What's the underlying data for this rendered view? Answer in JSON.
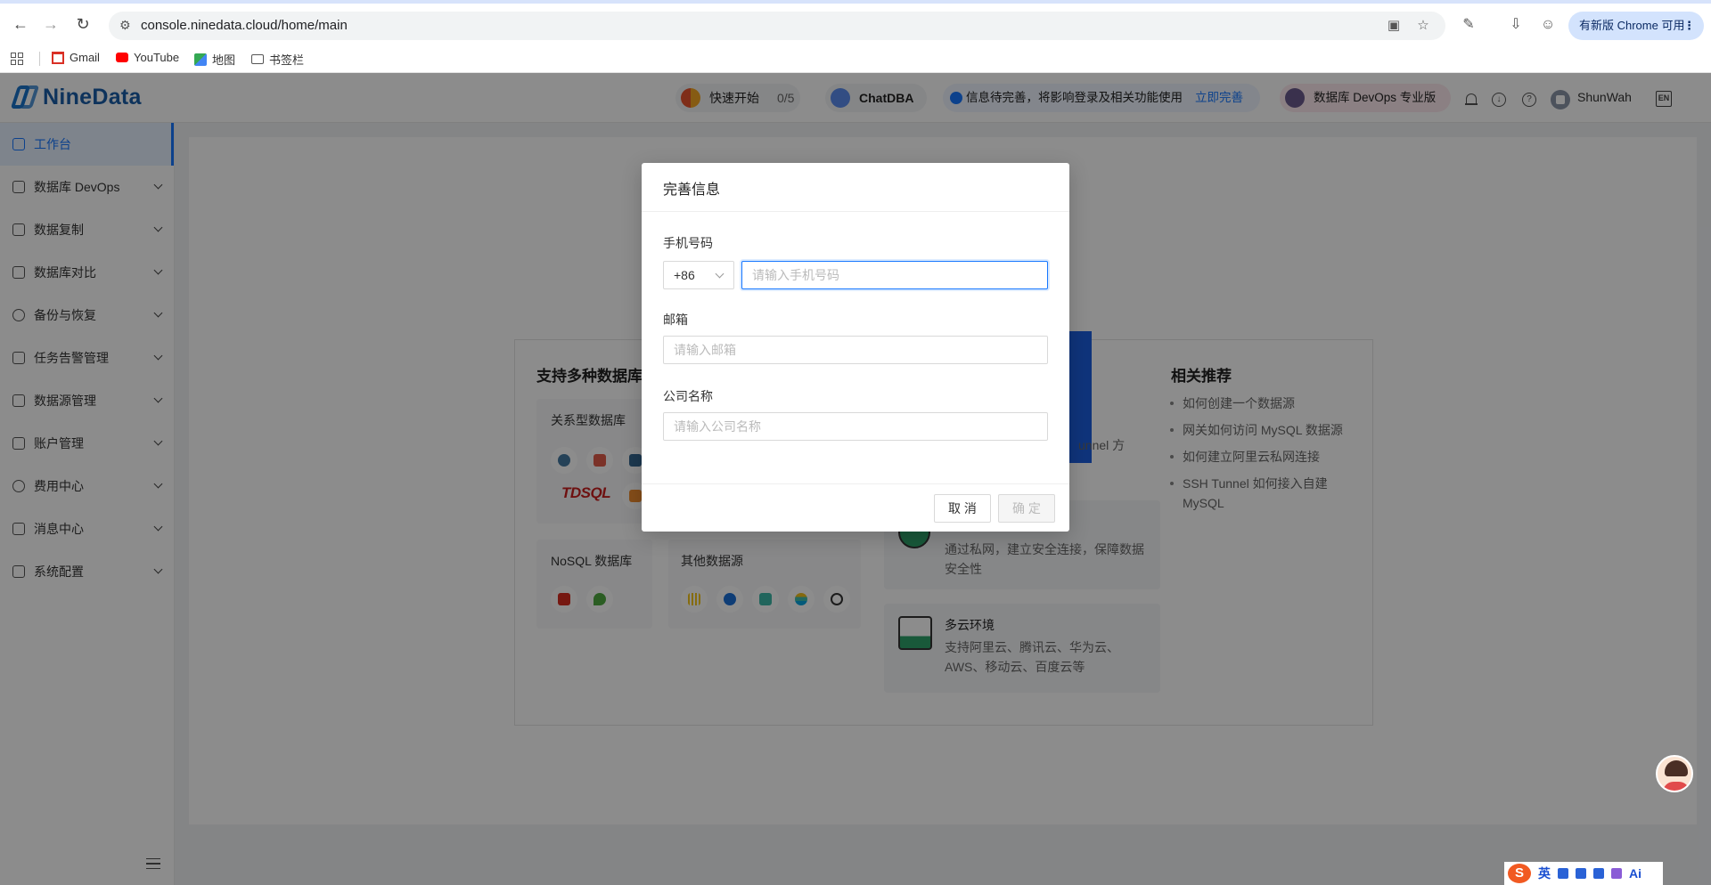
{
  "browser": {
    "url": "console.ninedata.cloud/home/main",
    "update_label": "有新版 Chrome 可用",
    "bookmarks": [
      {
        "label": "Gmail"
      },
      {
        "label": "YouTube"
      },
      {
        "label": "地图"
      },
      {
        "label": "书签栏"
      }
    ]
  },
  "header": {
    "brand": "NineData",
    "quick_start_label": "快速开始",
    "quick_start_progress": "0/5",
    "chatdba_label": "ChatDBA",
    "notice_text": "信息待完善，将影响登录及相关功能使用",
    "notice_link": "立即完善",
    "edition_label": "数据库 DevOps 专业版",
    "username": "ShunWah"
  },
  "sidebar": {
    "items": [
      {
        "label": "工作台"
      },
      {
        "label": "数据库 DevOps"
      },
      {
        "label": "数据复制"
      },
      {
        "label": "数据库对比"
      },
      {
        "label": "备份与恢复"
      },
      {
        "label": "任务告警管理"
      },
      {
        "label": "数据源管理"
      },
      {
        "label": "账户管理"
      },
      {
        "label": "费用中心"
      },
      {
        "label": "消息中心"
      },
      {
        "label": "系统配置"
      }
    ]
  },
  "main": {
    "support_title": "支持多种数据库",
    "relational_label": "关系型数据库",
    "tdsql_label": "TDSQL",
    "nosql_label": "NoSQL 数据库",
    "other_label": "其他数据源",
    "tunnel_fragment": "unnel 方",
    "private_desc": "通过私网，建立安全连接，保障数据安全性",
    "multicloud_title": "多云环境",
    "multicloud_desc": "支持阿里云、腾讯云、华为云、AWS、移动云、百度云等",
    "recommend_title": "相关推荐",
    "recommendations": [
      "如何创建一个数据源",
      "网关如何访问 MySQL 数据源",
      "如何建立阿里云私网连接",
      "SSH Tunnel 如何接入自建 MySQL"
    ]
  },
  "modal": {
    "title": "完善信息",
    "phone_label": "手机号码",
    "country_code": "+86",
    "phone_placeholder": "请输入手机号码",
    "email_label": "邮箱",
    "email_placeholder": "请输入邮箱",
    "company_label": "公司名称",
    "company_placeholder": "请输入公司名称",
    "cancel_label": "取 消",
    "ok_label": "确 定"
  },
  "ime": {
    "mode_label": "英"
  },
  "colors": {
    "accent": "#1677ff",
    "brand": "#1a5ea8",
    "banner": "#1d5fe0"
  }
}
